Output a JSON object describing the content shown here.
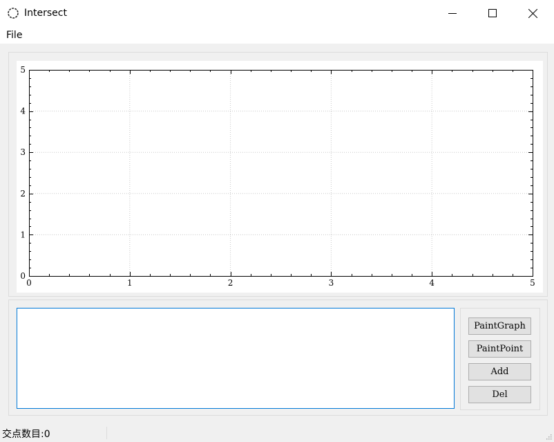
{
  "window": {
    "title": "Intersect",
    "app_icon": "ring-icon",
    "controls": [
      "minimize-icon",
      "maximize-icon",
      "close-icon"
    ]
  },
  "menu": {
    "items": [
      {
        "label": "File"
      }
    ]
  },
  "plot": {
    "x_range": [
      0,
      5
    ],
    "y_range": [
      0,
      5
    ],
    "x_ticks": [
      "0",
      "1",
      "2",
      "3",
      "4",
      "5"
    ],
    "y_ticks": [
      "0",
      "1",
      "2",
      "3",
      "4",
      "5"
    ],
    "grid": "dotted"
  },
  "editor": {
    "value": ""
  },
  "buttons": {
    "paint_graph": "PaintGraph",
    "paint_point": "PaintPoint",
    "add": "Add",
    "del": "Del"
  },
  "status": {
    "text": "交点数目:0"
  },
  "colors": {
    "focus_border": "#0078d7",
    "grid": "#c8c8c8",
    "axis": "#000000"
  }
}
